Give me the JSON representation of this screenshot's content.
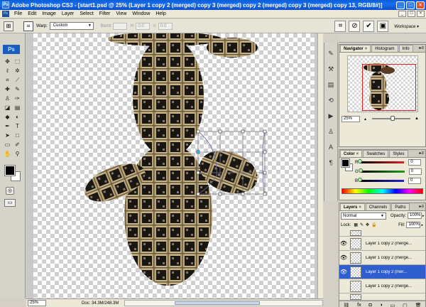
{
  "titlebar": {
    "title": "Adobe Photoshop CS3 - [start1.psd @ 25% (Layer 1 copy 2 (merged) copy 3 (merged) copy 2 (merged) copy 3 (merged) copy 13, RGB/8#)]",
    "app_icon": "Ps",
    "minimize": "_",
    "maximize": "□",
    "close": "×"
  },
  "menubar": {
    "items": [
      "File",
      "Edit",
      "Image",
      "Layer",
      "Select",
      "Filter",
      "View",
      "Window",
      "Help"
    ],
    "doc_controls": [
      "_",
      "□",
      "×"
    ]
  },
  "options": {
    "warp_label": "Warp:",
    "warp_value": "Custom",
    "bend_label": "Bend:",
    "bend_value": "",
    "h_label": "H:",
    "h_value": "0.0",
    "v_label": "V:",
    "v_value": "0.0",
    "workspace_label": "Workspace ▾"
  },
  "tools": {
    "logo": "Ps",
    "icons": [
      "move-icon",
      "marquee-icon",
      "lasso-icon",
      "magic-wand-icon",
      "crop-icon",
      "slice-icon",
      "healing-icon",
      "brush-icon",
      "stamp-icon",
      "history-brush-icon",
      "eraser-icon",
      "gradient-icon",
      "blur-icon",
      "dodge-icon",
      "pen-icon",
      "type-icon",
      "path-select-icon",
      "shape-icon",
      "notes-icon",
      "eyedropper-icon",
      "hand-icon",
      "zoom-icon"
    ]
  },
  "status": {
    "zoom": "25%",
    "doc": "Doc: 34.3M/248.3M"
  },
  "panels": {
    "navigator": {
      "tabs": [
        "Navigator",
        "Histogram",
        "Info"
      ],
      "zoom": "25%"
    },
    "color": {
      "tabs": [
        "Color",
        "Swatches",
        "Styles"
      ],
      "channels": [
        {
          "label": "R",
          "value": "0",
          "color": "#e02020"
        },
        {
          "label": "G",
          "value": "0",
          "color": "#20a020"
        },
        {
          "label": "B",
          "value": "0",
          "color": "#2020d0"
        }
      ]
    },
    "layers": {
      "tabs": [
        "Layers",
        "Channels",
        "Paths"
      ],
      "blend_mode": "Normal",
      "opacity_label": "Opacity:",
      "opacity": "100%",
      "lock_label": "Lock:",
      "fill_label": "Fill:",
      "fill": "100%",
      "rows": [
        {
          "name": "",
          "visible": false,
          "selected": false
        },
        {
          "name": "Layer 1 copy 2 (merge...",
          "visible": true,
          "selected": false
        },
        {
          "name": "Layer 1 copy 2 (merge...",
          "visible": true,
          "selected": false
        },
        {
          "name": "Layer 1 copy 2 (mer...",
          "visible": true,
          "selected": true
        },
        {
          "name": "Layer 1 copy 2 (merge...",
          "visible": false,
          "selected": false
        },
        {
          "name": "",
          "visible": false,
          "selected": false
        }
      ]
    }
  }
}
